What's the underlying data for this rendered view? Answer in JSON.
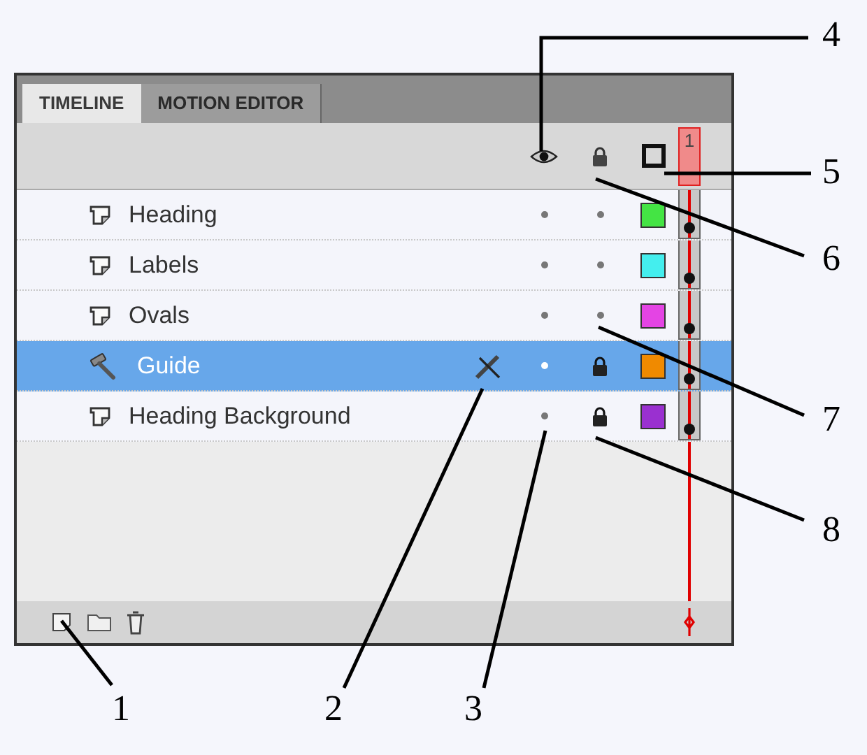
{
  "tabs": [
    {
      "label": "TIMELINE",
      "selected": true
    },
    {
      "label": "MOTION EDITOR",
      "selected": false
    }
  ],
  "playhead": {
    "frame": "1"
  },
  "layers": [
    {
      "name": "Heading",
      "kind": "normal",
      "selected": false,
      "editable": true,
      "visible": true,
      "locked": false,
      "color": "#44e444"
    },
    {
      "name": "Labels",
      "kind": "normal",
      "selected": false,
      "editable": true,
      "visible": true,
      "locked": false,
      "color": "#44eeee"
    },
    {
      "name": "Ovals",
      "kind": "normal",
      "selected": false,
      "editable": true,
      "visible": true,
      "locked": false,
      "color": "#e444e4"
    },
    {
      "name": "Guide",
      "kind": "guide",
      "selected": true,
      "editable": false,
      "visible": true,
      "locked": true,
      "color": "#f08a00"
    },
    {
      "name": "Heading Background",
      "kind": "normal",
      "selected": false,
      "editable": true,
      "visible": true,
      "locked": true,
      "color": "#9a30d0"
    }
  ],
  "callouts": [
    {
      "label": "4"
    },
    {
      "label": "5"
    },
    {
      "label": "6"
    },
    {
      "label": "7"
    },
    {
      "label": "8"
    },
    {
      "label": "1"
    },
    {
      "label": "2"
    },
    {
      "label": "3"
    }
  ]
}
